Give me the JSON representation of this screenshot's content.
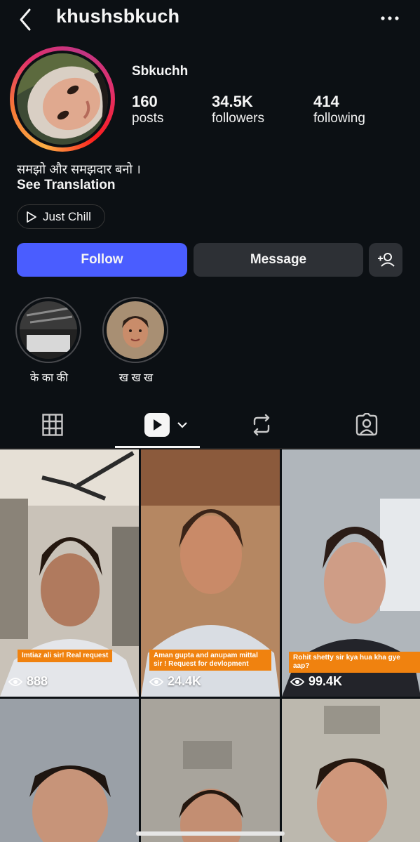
{
  "header": {
    "username": "khushsbkuch"
  },
  "profile": {
    "display_name": "Sbkuchh",
    "stats": [
      {
        "value": "160",
        "label": "posts"
      },
      {
        "value": "34.5K",
        "label": "followers"
      },
      {
        "value": "414",
        "label": "following"
      }
    ],
    "bio": "समझो और समझदार बनो ।",
    "see_translation": "See Translation",
    "chip_label": "Just Chill"
  },
  "actions": {
    "follow": "Follow",
    "message": "Message"
  },
  "highlights": [
    {
      "label": "के का की"
    },
    {
      "label": "ख ख ख"
    }
  ],
  "tabs": [
    "grid-icon",
    "reels-icon",
    "reposts-icon",
    "tagged-icon"
  ],
  "reels": [
    {
      "caption": "Imtiaz ali sir! Real request",
      "views": "888"
    },
    {
      "caption": "Aman gupta and anupam mittal sir ! Request for devlopment",
      "views": "24.4K"
    },
    {
      "caption": "Rohit shetty sir kya hua kha gye aap?",
      "views": "99.4K"
    }
  ],
  "colors": {
    "background": "#0c1014",
    "follow_button": "#4a5dff",
    "secondary_button": "#2d3035",
    "caption_bg": "#f0820f"
  }
}
